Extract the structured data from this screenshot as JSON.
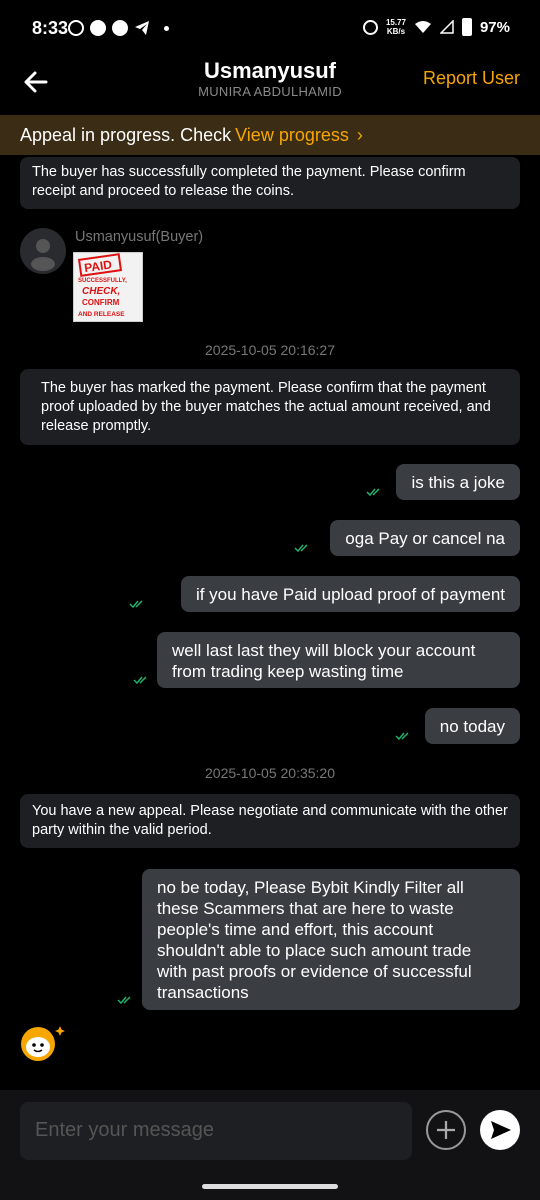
{
  "status": {
    "time": "8:33",
    "net_speed_value": "15.77",
    "net_speed_unit": "KB/s",
    "battery": "97%"
  },
  "header": {
    "title": "Usmanyusuf",
    "subtitle": "MUNIRA ABDULHAMID",
    "report": "Report User"
  },
  "appeal": {
    "text": "Appeal in progress. Check",
    "link": "View progress"
  },
  "messages": {
    "sys1": "The buyer has successfully completed the payment. Please confirm receipt and proceed to release the coins.",
    "buyer_name": "Usmanyusuf(Buyer)",
    "paid_image_text": "PAID SUCCESSFULLY, CHECK, CONFIRM AND RELEASE",
    "ts1": "2025-10-05 20:16:27",
    "sys2": "The buyer has marked the payment. Please confirm that the payment proof uploaded by the buyer matches the actual amount received, and release promptly.",
    "out1": "is this a joke",
    "out2": "oga Pay or cancel na",
    "out3": "if you have Paid upload proof of payment",
    "out4": "well last last they will block your account from trading keep wasting time",
    "out5": "no today",
    "ts2": "2025-10-05 20:35:20",
    "sys3": "You have a new appeal. Please negotiate and communicate with the other party within the valid period.",
    "out6": "no be today, Please Bybit Kindly Filter all these Scammers that are here to waste people's time and effort, this account shouldn't able to place such amount trade with past proofs or evidence of successful transactions"
  },
  "input": {
    "placeholder": "Enter your message"
  },
  "colors": {
    "accent": "#f7a600",
    "check": "#20b26c",
    "bubble": "#3a3d42",
    "system": "#1e1f22"
  }
}
